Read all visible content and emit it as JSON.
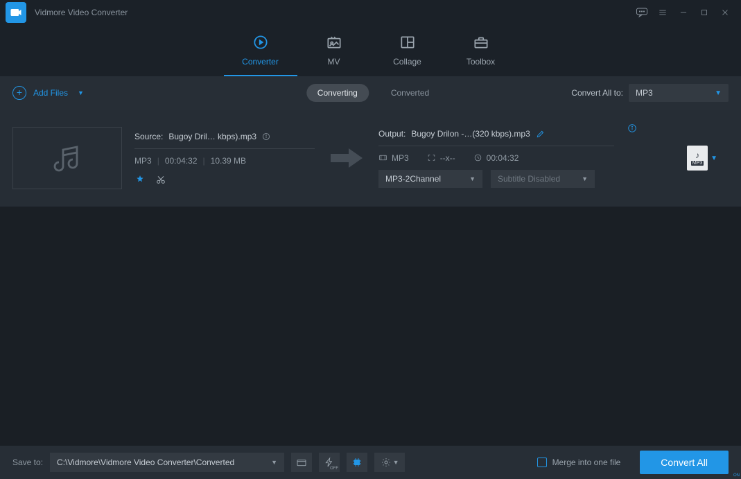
{
  "app": {
    "title": "Vidmore Video Converter"
  },
  "nav": {
    "items": [
      {
        "label": "Converter",
        "active": true
      },
      {
        "label": "MV",
        "active": false
      },
      {
        "label": "Collage",
        "active": false
      },
      {
        "label": "Toolbox",
        "active": false
      }
    ]
  },
  "toolbar": {
    "add_files_label": "Add Files",
    "converting_label": "Converting",
    "converted_label": "Converted",
    "convert_all_to_label": "Convert All to:",
    "convert_all_format": "MP3"
  },
  "file": {
    "source_label": "Source:",
    "source_name": "Bugoy Dril… kbps).mp3",
    "source_format": "MP3",
    "source_duration": "00:04:32",
    "source_size": "10.39 MB",
    "output_label": "Output:",
    "output_name": "Bugoy Drilon -…(320 kbps).mp3",
    "output_format": "MP3",
    "output_resolution": "--x--",
    "output_duration": "00:04:32",
    "audio_select": "MP3-2Channel",
    "subtitle_select": "Subtitle Disabled",
    "out_badge_format": "MP3"
  },
  "bottom": {
    "save_to_label": "Save to:",
    "save_path": "C:\\Vidmore\\Vidmore Video Converter\\Converted",
    "flash_state": "OFF",
    "accel_state": "ON",
    "merge_label": "Merge into one file",
    "convert_btn": "Convert All"
  },
  "colors": {
    "accent": "#2296e6"
  }
}
